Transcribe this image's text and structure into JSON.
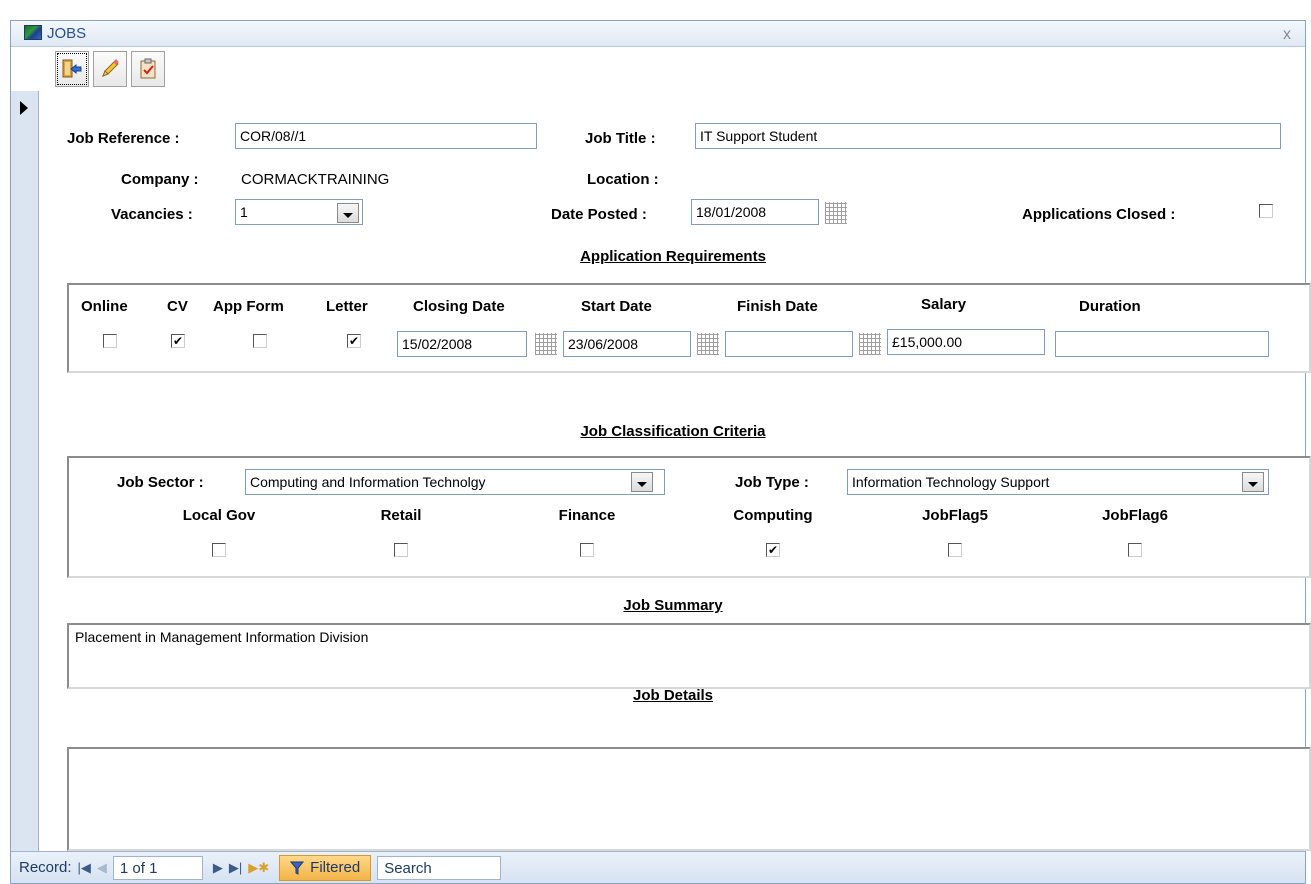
{
  "window": {
    "title": "JOBS",
    "close_glyph": "x"
  },
  "toolbar": {
    "buttons": [
      {
        "icon": "exit-door-icon"
      },
      {
        "icon": "pencil-icon"
      },
      {
        "icon": "clipboard-check-icon"
      }
    ]
  },
  "fields": {
    "job_reference_label": "Job Reference :",
    "job_reference_value": "COR/08//1",
    "job_title_label": "Job Title :",
    "job_title_value": "IT Support Student",
    "company_label": "Company :",
    "company_value": "CORMACKTRAINING",
    "location_label": "Location :",
    "location_value": "",
    "vacancies_label": "Vacancies :",
    "vacancies_value": "1",
    "date_posted_label": "Date Posted :",
    "date_posted_value": "18/01/2008",
    "applications_closed_label": "Applications Closed :",
    "applications_closed_checked": false
  },
  "application_requirements": {
    "title": "Application Requirements",
    "online_label": "Online",
    "online_checked": false,
    "cv_label": "CV",
    "cv_checked": true,
    "app_form_label": "App Form",
    "app_form_checked": false,
    "letter_label": "Letter",
    "letter_checked": true,
    "closing_date_label": "Closing Date",
    "closing_date_value": "15/02/2008",
    "start_date_label": "Start Date",
    "start_date_value": "23/06/2008",
    "finish_date_label": "Finish Date",
    "finish_date_value": "",
    "salary_label": "Salary",
    "salary_value": "£15,000.00",
    "duration_label": "Duration",
    "duration_value": ""
  },
  "classification": {
    "title": "Job Classification Criteria",
    "job_sector_label": "Job Sector :",
    "job_sector_value": "Computing and Information Technolgy",
    "job_type_label": "Job Type :",
    "job_type_value": "Information Technology Support",
    "flags": [
      {
        "label": "Local Gov",
        "checked": false
      },
      {
        "label": "Retail",
        "checked": false
      },
      {
        "label": "Finance",
        "checked": false
      },
      {
        "label": "Computing",
        "checked": true
      },
      {
        "label": "JobFlag5",
        "checked": false
      },
      {
        "label": "JobFlag6",
        "checked": false
      }
    ]
  },
  "summary": {
    "title": "Job Summary",
    "value": "Placement in Management Information Division"
  },
  "details": {
    "title": "Job Details",
    "value": ""
  },
  "status": {
    "record_label": "Record:",
    "position": "1 of 1",
    "filter_label": "Filtered",
    "search_label": "Search"
  },
  "colors": {
    "title_text": "#2a4f8f",
    "filter_button": "#f3b447",
    "record_selector": "#dbe5f1"
  }
}
